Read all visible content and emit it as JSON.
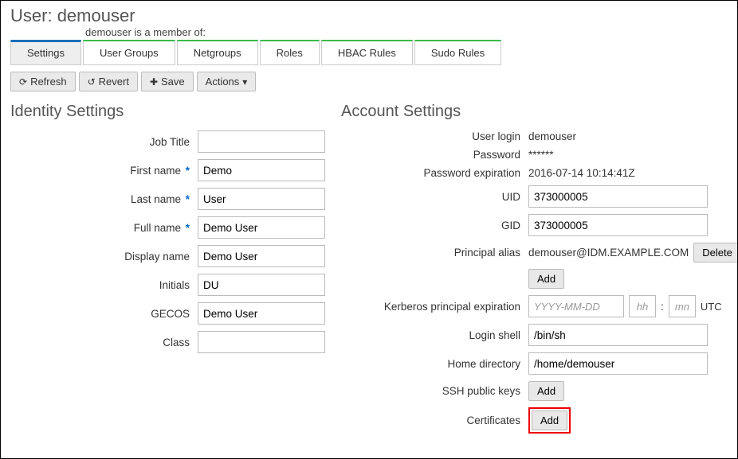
{
  "header": {
    "title_prefix": "User: ",
    "username": "demouser",
    "member_of_label": "demouser is a member of:"
  },
  "tabs": [
    {
      "label": "Settings",
      "active": true
    },
    {
      "label": "User Groups"
    },
    {
      "label": "Netgroups"
    },
    {
      "label": "Roles"
    },
    {
      "label": "HBAC Rules"
    },
    {
      "label": "Sudo Rules"
    }
  ],
  "toolbar": {
    "refresh": "Refresh",
    "revert": "Revert",
    "save": "Save",
    "actions": "Actions"
  },
  "identity": {
    "title": "Identity Settings",
    "job_title": {
      "label": "Job Title",
      "value": ""
    },
    "first_name": {
      "label": "First name",
      "value": "Demo",
      "required": true
    },
    "last_name": {
      "label": "Last name",
      "value": "User",
      "required": true
    },
    "full_name": {
      "label": "Full name",
      "value": "Demo User",
      "required": true
    },
    "display_name": {
      "label": "Display name",
      "value": "Demo User"
    },
    "initials": {
      "label": "Initials",
      "value": "DU"
    },
    "gecos": {
      "label": "GECOS",
      "value": "Demo User"
    },
    "class": {
      "label": "Class",
      "value": ""
    }
  },
  "account": {
    "title": "Account Settings",
    "user_login": {
      "label": "User login",
      "value": "demouser"
    },
    "password": {
      "label": "Password",
      "value": "******"
    },
    "password_expiration": {
      "label": "Password expiration",
      "value": "2016-07-14 10:14:41Z"
    },
    "uid": {
      "label": "UID",
      "value": "373000005"
    },
    "gid": {
      "label": "GID",
      "value": "373000005"
    },
    "principal_alias": {
      "label": "Principal alias",
      "value": "demouser@IDM.EXAMPLE.COM",
      "delete": "Delete",
      "add": "Add"
    },
    "krb_expiration": {
      "label": "Kerberos principal expiration",
      "date_ph": "YYYY-MM-DD",
      "hh_ph": "hh",
      "mn_ph": "mn",
      "utc": "UTC"
    },
    "login_shell": {
      "label": "Login shell",
      "value": "/bin/sh"
    },
    "home_dir": {
      "label": "Home directory",
      "value": "/home/demouser"
    },
    "ssh_keys": {
      "label": "SSH public keys",
      "add": "Add"
    },
    "certificates": {
      "label": "Certificates",
      "add": "Add"
    }
  }
}
